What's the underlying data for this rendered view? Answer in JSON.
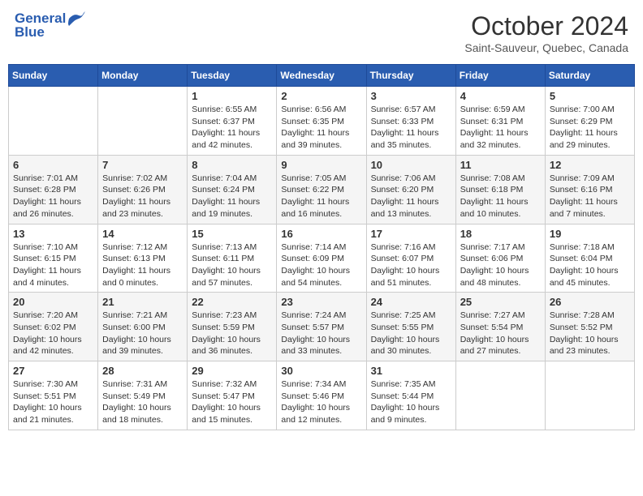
{
  "header": {
    "logo_line1": "General",
    "logo_line2": "Blue",
    "month": "October 2024",
    "location": "Saint-Sauveur, Quebec, Canada"
  },
  "columns": [
    "Sunday",
    "Monday",
    "Tuesday",
    "Wednesday",
    "Thursday",
    "Friday",
    "Saturday"
  ],
  "weeks": [
    [
      {
        "day": "",
        "sunrise": "",
        "sunset": "",
        "daylight": ""
      },
      {
        "day": "",
        "sunrise": "",
        "sunset": "",
        "daylight": ""
      },
      {
        "day": "1",
        "sunrise": "Sunrise: 6:55 AM",
        "sunset": "Sunset: 6:37 PM",
        "daylight": "Daylight: 11 hours and 42 minutes."
      },
      {
        "day": "2",
        "sunrise": "Sunrise: 6:56 AM",
        "sunset": "Sunset: 6:35 PM",
        "daylight": "Daylight: 11 hours and 39 minutes."
      },
      {
        "day": "3",
        "sunrise": "Sunrise: 6:57 AM",
        "sunset": "Sunset: 6:33 PM",
        "daylight": "Daylight: 11 hours and 35 minutes."
      },
      {
        "day": "4",
        "sunrise": "Sunrise: 6:59 AM",
        "sunset": "Sunset: 6:31 PM",
        "daylight": "Daylight: 11 hours and 32 minutes."
      },
      {
        "day": "5",
        "sunrise": "Sunrise: 7:00 AM",
        "sunset": "Sunset: 6:29 PM",
        "daylight": "Daylight: 11 hours and 29 minutes."
      }
    ],
    [
      {
        "day": "6",
        "sunrise": "Sunrise: 7:01 AM",
        "sunset": "Sunset: 6:28 PM",
        "daylight": "Daylight: 11 hours and 26 minutes."
      },
      {
        "day": "7",
        "sunrise": "Sunrise: 7:02 AM",
        "sunset": "Sunset: 6:26 PM",
        "daylight": "Daylight: 11 hours and 23 minutes."
      },
      {
        "day": "8",
        "sunrise": "Sunrise: 7:04 AM",
        "sunset": "Sunset: 6:24 PM",
        "daylight": "Daylight: 11 hours and 19 minutes."
      },
      {
        "day": "9",
        "sunrise": "Sunrise: 7:05 AM",
        "sunset": "Sunset: 6:22 PM",
        "daylight": "Daylight: 11 hours and 16 minutes."
      },
      {
        "day": "10",
        "sunrise": "Sunrise: 7:06 AM",
        "sunset": "Sunset: 6:20 PM",
        "daylight": "Daylight: 11 hours and 13 minutes."
      },
      {
        "day": "11",
        "sunrise": "Sunrise: 7:08 AM",
        "sunset": "Sunset: 6:18 PM",
        "daylight": "Daylight: 11 hours and 10 minutes."
      },
      {
        "day": "12",
        "sunrise": "Sunrise: 7:09 AM",
        "sunset": "Sunset: 6:16 PM",
        "daylight": "Daylight: 11 hours and 7 minutes."
      }
    ],
    [
      {
        "day": "13",
        "sunrise": "Sunrise: 7:10 AM",
        "sunset": "Sunset: 6:15 PM",
        "daylight": "Daylight: 11 hours and 4 minutes."
      },
      {
        "day": "14",
        "sunrise": "Sunrise: 7:12 AM",
        "sunset": "Sunset: 6:13 PM",
        "daylight": "Daylight: 11 hours and 0 minutes."
      },
      {
        "day": "15",
        "sunrise": "Sunrise: 7:13 AM",
        "sunset": "Sunset: 6:11 PM",
        "daylight": "Daylight: 10 hours and 57 minutes."
      },
      {
        "day": "16",
        "sunrise": "Sunrise: 7:14 AM",
        "sunset": "Sunset: 6:09 PM",
        "daylight": "Daylight: 10 hours and 54 minutes."
      },
      {
        "day": "17",
        "sunrise": "Sunrise: 7:16 AM",
        "sunset": "Sunset: 6:07 PM",
        "daylight": "Daylight: 10 hours and 51 minutes."
      },
      {
        "day": "18",
        "sunrise": "Sunrise: 7:17 AM",
        "sunset": "Sunset: 6:06 PM",
        "daylight": "Daylight: 10 hours and 48 minutes."
      },
      {
        "day": "19",
        "sunrise": "Sunrise: 7:18 AM",
        "sunset": "Sunset: 6:04 PM",
        "daylight": "Daylight: 10 hours and 45 minutes."
      }
    ],
    [
      {
        "day": "20",
        "sunrise": "Sunrise: 7:20 AM",
        "sunset": "Sunset: 6:02 PM",
        "daylight": "Daylight: 10 hours and 42 minutes."
      },
      {
        "day": "21",
        "sunrise": "Sunrise: 7:21 AM",
        "sunset": "Sunset: 6:00 PM",
        "daylight": "Daylight: 10 hours and 39 minutes."
      },
      {
        "day": "22",
        "sunrise": "Sunrise: 7:23 AM",
        "sunset": "Sunset: 5:59 PM",
        "daylight": "Daylight: 10 hours and 36 minutes."
      },
      {
        "day": "23",
        "sunrise": "Sunrise: 7:24 AM",
        "sunset": "Sunset: 5:57 PM",
        "daylight": "Daylight: 10 hours and 33 minutes."
      },
      {
        "day": "24",
        "sunrise": "Sunrise: 7:25 AM",
        "sunset": "Sunset: 5:55 PM",
        "daylight": "Daylight: 10 hours and 30 minutes."
      },
      {
        "day": "25",
        "sunrise": "Sunrise: 7:27 AM",
        "sunset": "Sunset: 5:54 PM",
        "daylight": "Daylight: 10 hours and 27 minutes."
      },
      {
        "day": "26",
        "sunrise": "Sunrise: 7:28 AM",
        "sunset": "Sunset: 5:52 PM",
        "daylight": "Daylight: 10 hours and 23 minutes."
      }
    ],
    [
      {
        "day": "27",
        "sunrise": "Sunrise: 7:30 AM",
        "sunset": "Sunset: 5:51 PM",
        "daylight": "Daylight: 10 hours and 21 minutes."
      },
      {
        "day": "28",
        "sunrise": "Sunrise: 7:31 AM",
        "sunset": "Sunset: 5:49 PM",
        "daylight": "Daylight: 10 hours and 18 minutes."
      },
      {
        "day": "29",
        "sunrise": "Sunrise: 7:32 AM",
        "sunset": "Sunset: 5:47 PM",
        "daylight": "Daylight: 10 hours and 15 minutes."
      },
      {
        "day": "30",
        "sunrise": "Sunrise: 7:34 AM",
        "sunset": "Sunset: 5:46 PM",
        "daylight": "Daylight: 10 hours and 12 minutes."
      },
      {
        "day": "31",
        "sunrise": "Sunrise: 7:35 AM",
        "sunset": "Sunset: 5:44 PM",
        "daylight": "Daylight: 10 hours and 9 minutes."
      },
      {
        "day": "",
        "sunrise": "",
        "sunset": "",
        "daylight": ""
      },
      {
        "day": "",
        "sunrise": "",
        "sunset": "",
        "daylight": ""
      }
    ]
  ]
}
